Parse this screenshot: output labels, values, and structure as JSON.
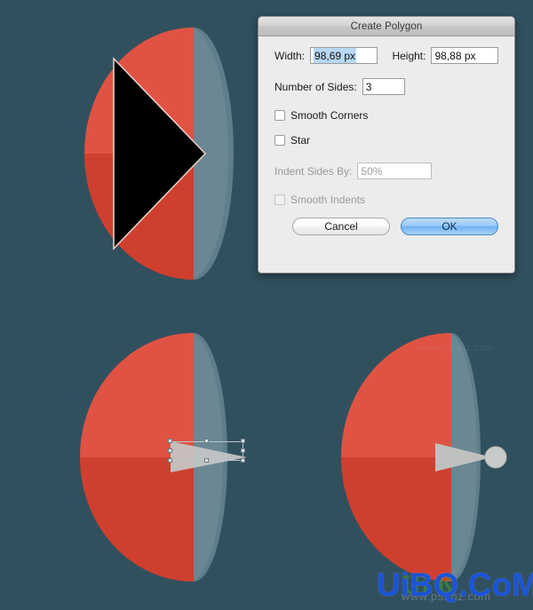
{
  "canvas": {
    "background_color": "#31505e",
    "shape_colors": {
      "dome_top_red": "#e05344",
      "dome_bottom_red": "#cf3f2f",
      "dome_side_blue_gray": "#65818d",
      "dome_side_blue_gray_dark": "#5c7886",
      "cone_gray": "#c1c3c1",
      "sphere_gray": "#c9cbc9",
      "triangle_black": "#000000",
      "triangle_stroke": "#e6c8c2"
    }
  },
  "dialog": {
    "title": "Create Polygon",
    "fields": {
      "width_label": "Width:",
      "width_value": "98,69 px",
      "height_label": "Height:",
      "height_value": "98,88 px",
      "sides_label": "Number of Sides:",
      "sides_value": "3",
      "indent_label": "Indent Sides By:",
      "indent_value": "50%"
    },
    "checkboxes": {
      "smooth_corners_label": "Smooth Corners",
      "smooth_corners_checked": false,
      "star_label": "Star",
      "star_checked": false,
      "smooth_indents_label": "Smooth Indents",
      "smooth_indents_checked": false,
      "smooth_indents_disabled": true
    },
    "buttons": {
      "cancel_label": "Cancel",
      "ok_label": "OK"
    },
    "accent_color": "#6fb2f2"
  },
  "watermarks": {
    "main": "UiBQ.CoM",
    "green_overlay": "Uí ß",
    "sub": "www.psahz.com",
    "faint": "www.psahz.com"
  },
  "selection": {
    "handle_count": 8,
    "handle_color": "#dce4e8",
    "handle_border_color": "#6d7c85"
  }
}
